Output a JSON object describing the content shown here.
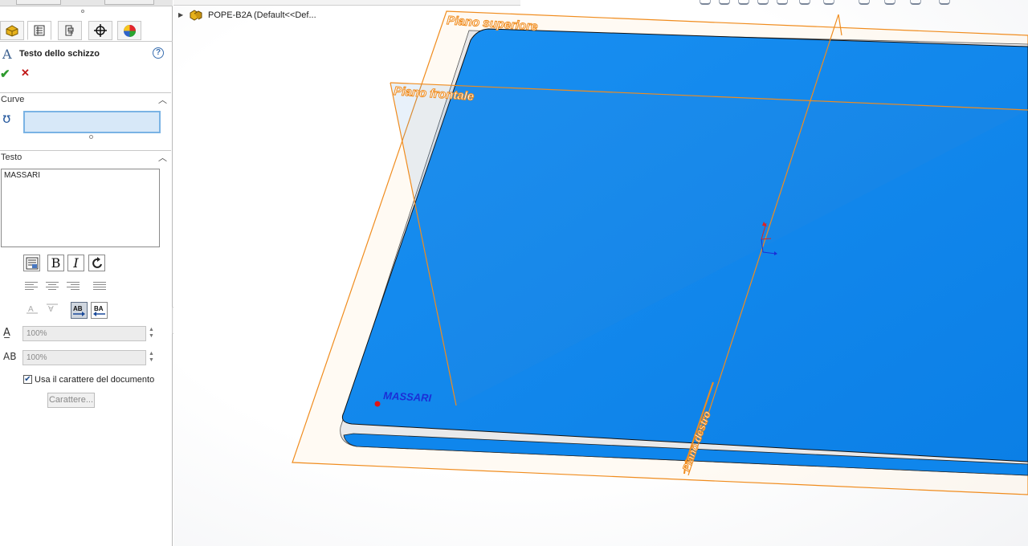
{
  "property_manager": {
    "title": "Testo dello schizzo",
    "help_icon": "help-icon",
    "ok_icon": "check-icon",
    "cancel_icon": "cross-icon",
    "curve_section": {
      "label": "Curve",
      "value": ""
    },
    "text_section": {
      "label": "Testo",
      "value": "MASSARI"
    },
    "width_factor": "100%",
    "spacing": "100%",
    "use_document_font": {
      "label": "Usa il carattere del documento",
      "checked": true
    },
    "font_button": "Carattere...",
    "format_buttons": [
      "bold",
      "italic",
      "rotate"
    ],
    "tabs": [
      "feature-manager-icon",
      "property-manager-icon",
      "configuration-manager-icon",
      "dimxpert-icon",
      "appearance-icon"
    ]
  },
  "tree": {
    "part_name": "POPE-B2A",
    "configuration": "(Default<<Def..."
  },
  "viewport": {
    "planes": [
      {
        "name": "Piano superiore"
      },
      {
        "name": "Piano frontale"
      },
      {
        "name": "Piano destro"
      }
    ],
    "sketch_text": "MASSARI",
    "part_color": "#0f86ec",
    "plane_color": "#f08c1e",
    "sketch_color": "#1b2fd6"
  }
}
